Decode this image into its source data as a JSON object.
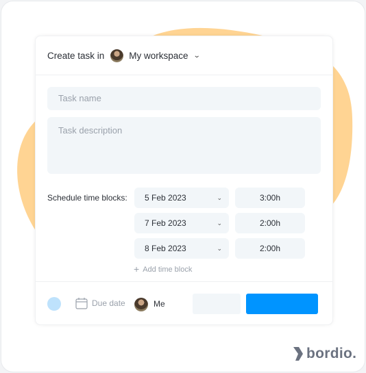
{
  "header": {
    "prefix": "Create task in",
    "workspace": "My workspace",
    "workspace_chevron": "chevron-down-icon"
  },
  "form": {
    "task_name_placeholder": "Task name",
    "task_description_placeholder": "Task description",
    "schedule_label": "Schedule time blocks:",
    "time_blocks": [
      {
        "date": "5 Feb 2023",
        "duration": "3:00h"
      },
      {
        "date": "7 Feb 2023",
        "duration": "2:00h"
      },
      {
        "date": "8 Feb 2023",
        "duration": "2:00h"
      }
    ],
    "add_time_block": "Add time block"
  },
  "footer": {
    "color_swatch": "#bee2fc",
    "due_date": "Due date",
    "assignee": "Me",
    "primary_color": "#0094ff"
  },
  "brand": {
    "name": "bordio.",
    "blob_color": "#ffd493"
  }
}
